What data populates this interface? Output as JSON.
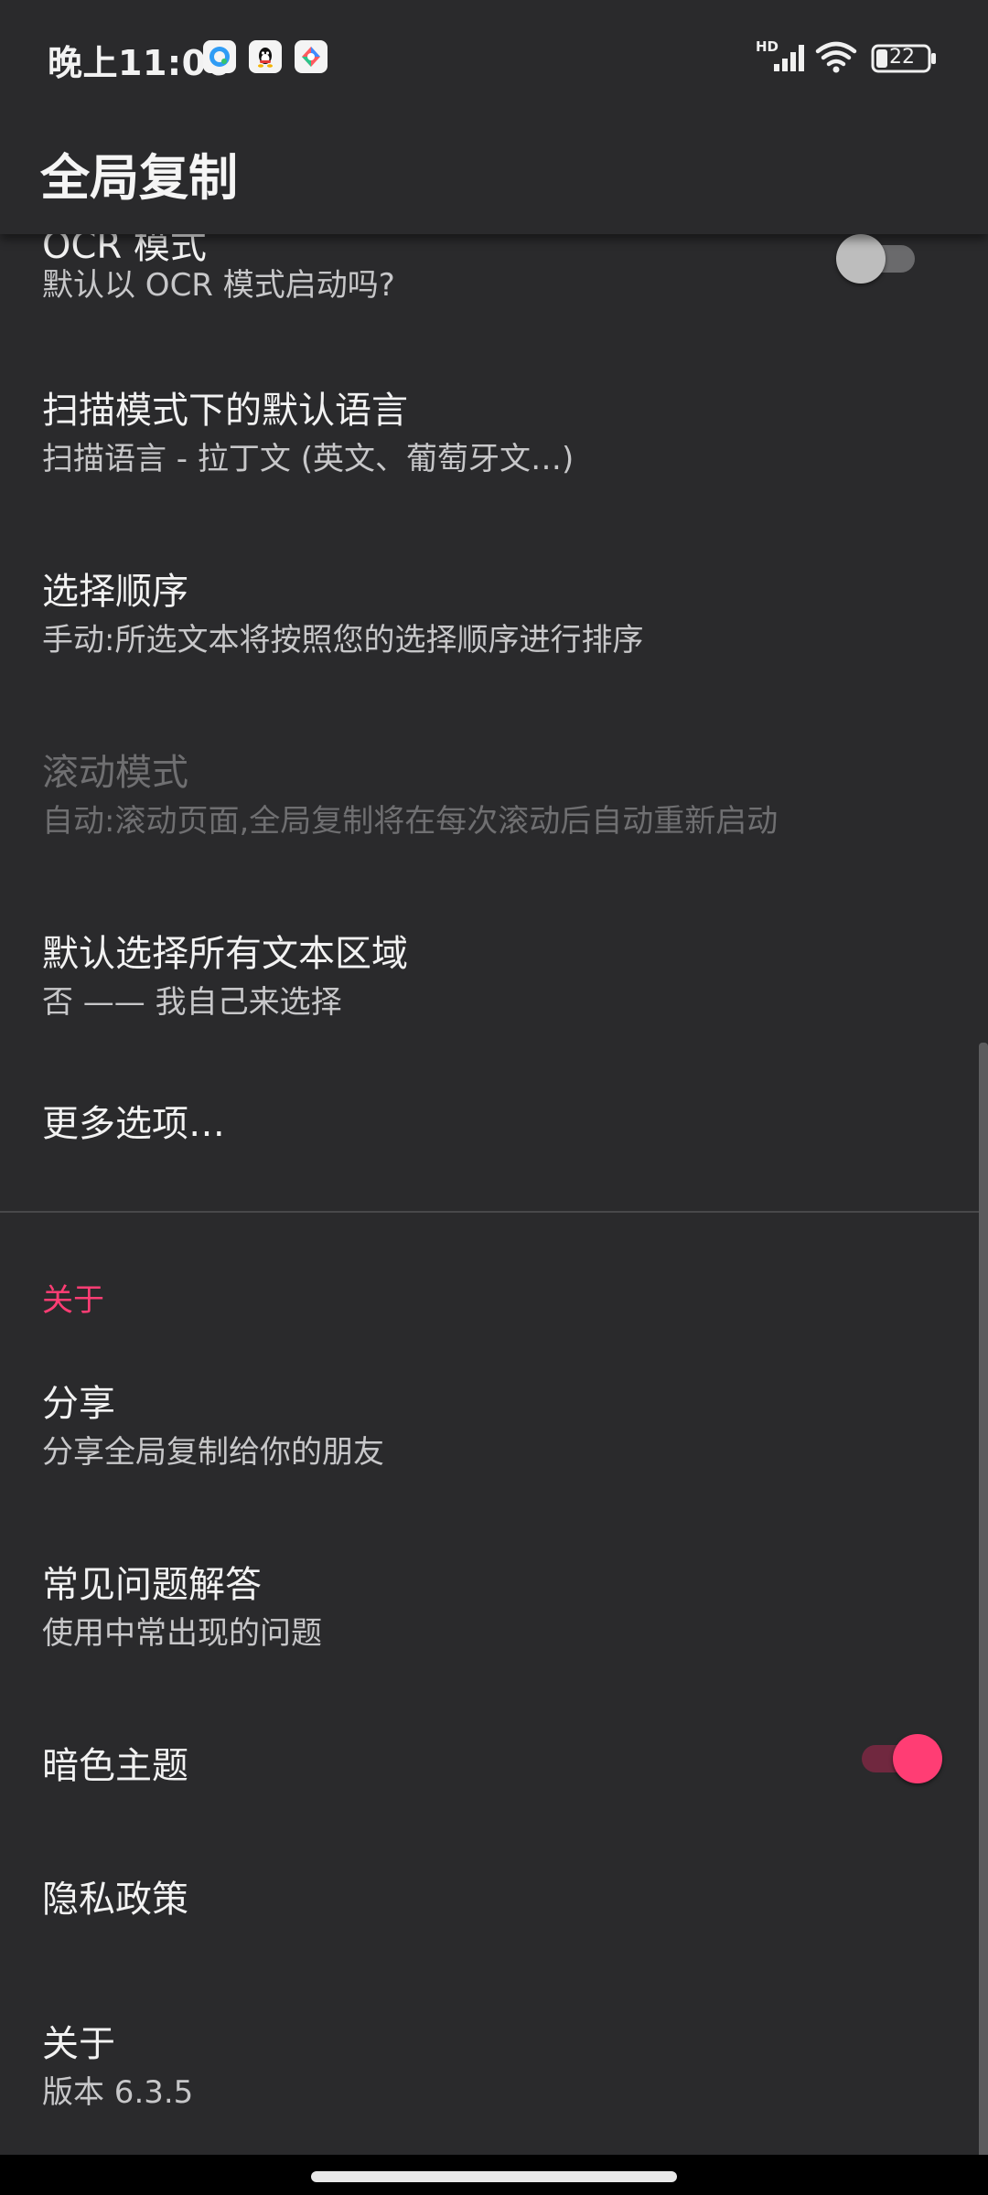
{
  "status_bar": {
    "time": "晚上11:06",
    "battery": "22",
    "signal_label": "HD"
  },
  "app_bar": {
    "title": "全局复制"
  },
  "prefs": {
    "ocr_mode": {
      "title": "OCR 模式",
      "summary": "默认以 OCR 模式启动吗?",
      "enabled": false
    },
    "scan_language": {
      "title": "扫描模式下的默认语言",
      "summary": "扫描语言 - 拉丁文 (英文、葡萄牙文…)"
    },
    "selection_order": {
      "title": "选择顺序",
      "summary": "手动:所选文本将按照您的选择顺序进行排序"
    },
    "scroll_mode": {
      "title": "滚动模式",
      "summary": "自动:滚动页面,全局复制将在每次滚动后自动重新启动"
    },
    "select_all": {
      "title": "默认选择所有文本区域",
      "summary": "否 —— 我自己来选择"
    },
    "more_options": {
      "title": "更多选项…"
    }
  },
  "about_category": {
    "label": "关于",
    "share": {
      "title": "分享",
      "summary": "分享全局复制给你的朋友"
    },
    "faq": {
      "title": "常见问题解答",
      "summary": "使用中常出现的问题"
    },
    "dark_theme": {
      "title": "暗色主题",
      "enabled": true
    },
    "privacy": {
      "title": "隐私政策"
    },
    "about": {
      "title": "关于",
      "summary": "版本 6.3.5"
    }
  },
  "colors": {
    "background": "#2a2a2c",
    "accent": "#ff3d74",
    "text_primary": "#f2f2f2",
    "text_secondary": "#c7c7c9",
    "text_disabled": "#6f6f71"
  }
}
